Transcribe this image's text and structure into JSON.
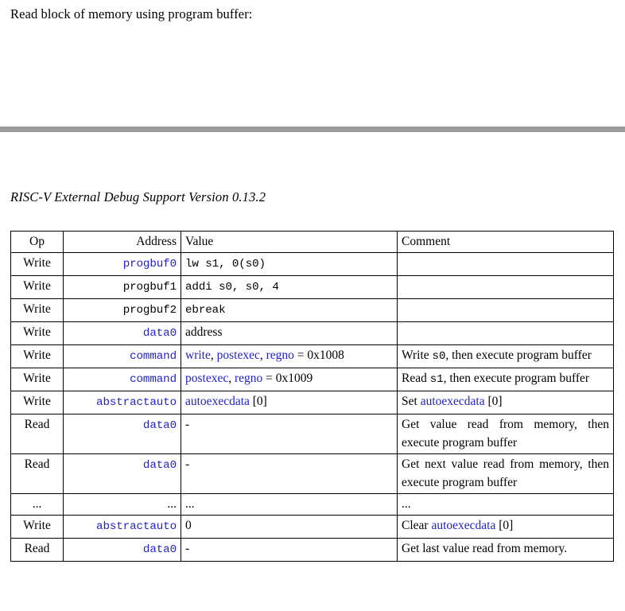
{
  "document": {
    "intro": "Read block of memory using program buffer:",
    "running_header": "RISC-V External Debug Support Version 0.13.2",
    "rule_color": "#9b9b9b",
    "link_color": "#2222cc"
  },
  "table": {
    "columns": [
      {
        "key": "op",
        "label": "Op",
        "align": "center"
      },
      {
        "key": "address",
        "label": "Address",
        "align": "right"
      },
      {
        "key": "value",
        "label": "Value",
        "align": "left"
      },
      {
        "key": "comment",
        "label": "Comment",
        "align": "left"
      }
    ],
    "rows": [
      {
        "op": "Write",
        "address": "progbuf0",
        "address_style": "mono-link",
        "value": "lw s1, 0(s0)",
        "value_style": "mono",
        "comment": ""
      },
      {
        "op": "Write",
        "address": "progbuf1",
        "address_style": "mono",
        "value": "addi s0, s0, 4",
        "value_style": "mono",
        "comment": ""
      },
      {
        "op": "Write",
        "address": "progbuf2",
        "address_style": "mono",
        "value": "ebreak",
        "value_style": "mono",
        "comment": ""
      },
      {
        "op": "Write",
        "address": "data0",
        "address_style": "mono-link",
        "value": "address",
        "value_style": "serif",
        "comment": ""
      },
      {
        "op": "Write",
        "address": "command",
        "address_style": "mono-link",
        "value_parts": [
          {
            "text": "write",
            "style": "link"
          },
          {
            "text": ", ",
            "style": "plain"
          },
          {
            "text": "postexec",
            "style": "link"
          },
          {
            "text": ", ",
            "style": "plain"
          },
          {
            "text": "regno",
            "style": "link"
          },
          {
            "text": " = 0x1008",
            "style": "plain"
          }
        ],
        "value_text": "write, postexec, regno = 0x1008",
        "comment": "Write s0, then execute program buffer",
        "comment_parts": [
          {
            "text": "Write ",
            "style": "plain"
          },
          {
            "text": "s0",
            "style": "mono"
          },
          {
            "text": ", then execute program buffer",
            "style": "plain"
          }
        ]
      },
      {
        "op": "Write",
        "address": "command",
        "address_style": "mono-link",
        "value_parts": [
          {
            "text": "postexec",
            "style": "link"
          },
          {
            "text": ", ",
            "style": "plain"
          },
          {
            "text": "regno",
            "style": "link"
          },
          {
            "text": " = 0x1009",
            "style": "plain"
          }
        ],
        "value_text": "postexec, regno = 0x1009",
        "comment": "Read s1, then execute program buffer",
        "comment_parts": [
          {
            "text": "Read ",
            "style": "plain"
          },
          {
            "text": "s1",
            "style": "mono"
          },
          {
            "text": ", then execute program buffer",
            "style": "plain"
          }
        ]
      },
      {
        "op": "Write",
        "address": "abstractauto",
        "address_style": "mono-link",
        "value_parts": [
          {
            "text": "autoexecdata",
            "style": "link"
          },
          {
            "text": " [0]",
            "style": "plain"
          }
        ],
        "value_text": "autoexecdata [0]",
        "comment": "Set autoexecdata [0]",
        "comment_parts": [
          {
            "text": "Set ",
            "style": "plain"
          },
          {
            "text": "autoexecdata",
            "style": "link"
          },
          {
            "text": " [0]",
            "style": "plain"
          }
        ]
      },
      {
        "op": "Read",
        "address": "data0",
        "address_style": "mono-link",
        "value": "-",
        "value_style": "serif",
        "comment": "Get value read from memory, then execute program buffer"
      },
      {
        "op": "Read",
        "address": "data0",
        "address_style": "mono-link",
        "value": "-",
        "value_style": "serif",
        "comment": "Get next value read from memory, then execute program buffer"
      },
      {
        "op": "...",
        "address": "...",
        "address_style": "serif",
        "value": "...",
        "value_style": "serif",
        "comment": "..."
      },
      {
        "op": "Write",
        "address": "abstractauto",
        "address_style": "mono-link",
        "value": "0",
        "value_style": "serif",
        "comment": "Clear autoexecdata [0]",
        "comment_parts": [
          {
            "text": "Clear ",
            "style": "plain"
          },
          {
            "text": "autoexecdata",
            "style": "link"
          },
          {
            "text": " [0]",
            "style": "plain"
          }
        ]
      },
      {
        "op": "Read",
        "address": "data0",
        "address_style": "mono-link",
        "value": "-",
        "value_style": "serif",
        "comment": "Get last value read from memory."
      }
    ]
  }
}
